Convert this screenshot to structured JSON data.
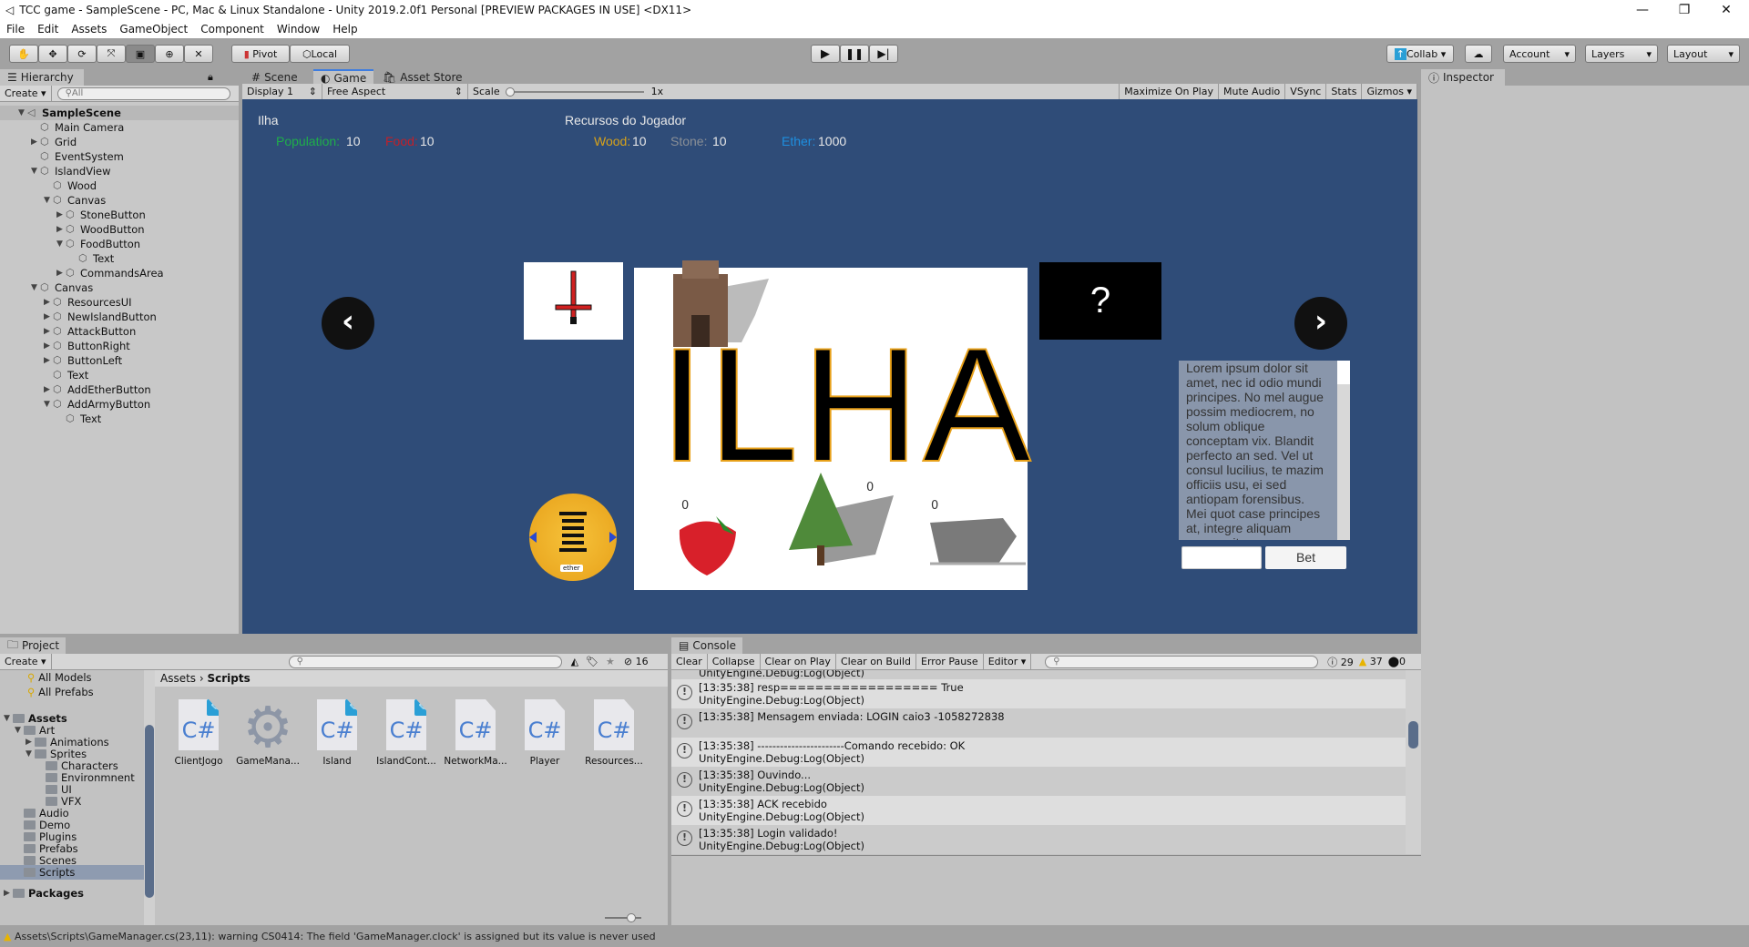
{
  "window": {
    "title": "TCC game - SampleScene - PC, Mac & Linux Standalone - Unity 2019.2.0f1 Personal [PREVIEW PACKAGES IN USE] <DX11>"
  },
  "menu": [
    "File",
    "Edit",
    "Assets",
    "GameObject",
    "Component",
    "Window",
    "Help"
  ],
  "toolbar": {
    "pivot": "Pivot",
    "local": "Local",
    "collab": "Collab ▾",
    "account": "Account",
    "layers": "Layers",
    "layout": "Layout"
  },
  "tabs": {
    "hierarchy": "Hierarchy",
    "scene": "Scene",
    "game": "Game",
    "asset_store": "Asset Store",
    "inspector": "Inspector",
    "project": "Project",
    "console": "Console"
  },
  "hierarchy": {
    "create": "Create",
    "search_placeholder": "All",
    "items": [
      {
        "label": "SampleScene",
        "depth": 0,
        "arrow": "▼",
        "bold": true
      },
      {
        "label": "Main Camera",
        "depth": 1,
        "arrow": ""
      },
      {
        "label": "Grid",
        "depth": 1,
        "arrow": "▶"
      },
      {
        "label": "EventSystem",
        "depth": 1,
        "arrow": ""
      },
      {
        "label": "IslandView",
        "depth": 1,
        "arrow": "▼"
      },
      {
        "label": "Wood",
        "depth": 2,
        "arrow": ""
      },
      {
        "label": "Canvas",
        "depth": 2,
        "arrow": "▼"
      },
      {
        "label": "StoneButton",
        "depth": 3,
        "arrow": "▶"
      },
      {
        "label": "WoodButton",
        "depth": 3,
        "arrow": "▶"
      },
      {
        "label": "FoodButton",
        "depth": 3,
        "arrow": "▼"
      },
      {
        "label": "Text",
        "depth": 4,
        "arrow": ""
      },
      {
        "label": "CommandsArea",
        "depth": 3,
        "arrow": "▶"
      },
      {
        "label": "Canvas",
        "depth": 1,
        "arrow": "▼"
      },
      {
        "label": "ResourcesUI",
        "depth": 2,
        "arrow": "▶"
      },
      {
        "label": "NewIslandButton",
        "depth": 2,
        "arrow": "▶"
      },
      {
        "label": "AttackButton",
        "depth": 2,
        "arrow": "▶"
      },
      {
        "label": "ButtonRight",
        "depth": 2,
        "arrow": "▶"
      },
      {
        "label": "ButtonLeft",
        "depth": 2,
        "arrow": "▶"
      },
      {
        "label": "Text",
        "depth": 2,
        "arrow": ""
      },
      {
        "label": "AddEtherButton",
        "depth": 2,
        "arrow": "▶"
      },
      {
        "label": "AddArmyButton",
        "depth": 2,
        "arrow": "▼"
      },
      {
        "label": "Text",
        "depth": 3,
        "arrow": ""
      }
    ]
  },
  "game_toolbar": {
    "display": "Display 1",
    "aspect": "Free Aspect",
    "scale_label": "Scale",
    "scale_value": "1x",
    "maximize": "Maximize On Play",
    "mute": "Mute Audio",
    "vsync": "VSync",
    "stats": "Stats",
    "gizmos": "Gizmos"
  },
  "game": {
    "island_label": "Ilha",
    "population_label": "Population:",
    "population": "10",
    "food_label": "Food:",
    "food": "10",
    "resources_title": "Recursos do Jogador",
    "wood_label": "Wood:",
    "wood": "10",
    "stone_label": "Stone:",
    "stone": "10",
    "ether_label": "Ether:",
    "ether": "1000",
    "island_name": "ILHA",
    "unknown": "?",
    "food_count": "0",
    "wood_count": "0",
    "stone_count": "0",
    "ether_coin": "ether",
    "lorem": "Lorem ipsum dolor sit amet, nec id odio mundi principes. No mel augue possim mediocrem, no solum oblique conceptam vix. Blandit perfecto an sed. Vel ut consul lucilius, te mazim officiis usu, ei sed antiopam forensibus. Mei quot case principes at, integre aliquam corrumpit mea ne",
    "bet_input": "",
    "bet": "Bet",
    "colors": {
      "population": "#1fae4a",
      "food": "#c0202a",
      "wood": "#d7a21a",
      "stone": "#8a8f96",
      "ether": "#1e8fe0",
      "background": "#2f4c78"
    }
  },
  "project": {
    "create": "Create",
    "hidden_count": "16",
    "favorites": [
      "All Models",
      "All Prefabs"
    ],
    "breadcrumb": [
      "Assets",
      "Scripts"
    ],
    "tree": [
      {
        "label": "Assets",
        "depth": 0,
        "arrow": "▼",
        "bold": true
      },
      {
        "label": "Art",
        "depth": 1,
        "arrow": "▼"
      },
      {
        "label": "Animations",
        "depth": 2,
        "arrow": "▶"
      },
      {
        "label": "Sprites",
        "depth": 2,
        "arrow": "▼"
      },
      {
        "label": "Characters",
        "depth": 3,
        "arrow": ""
      },
      {
        "label": "Environmnent",
        "depth": 3,
        "arrow": ""
      },
      {
        "label": "UI",
        "depth": 3,
        "arrow": ""
      },
      {
        "label": "VFX",
        "depth": 3,
        "arrow": ""
      },
      {
        "label": "Audio",
        "depth": 1,
        "arrow": ""
      },
      {
        "label": "Demo",
        "depth": 1,
        "arrow": ""
      },
      {
        "label": "Plugins",
        "depth": 1,
        "arrow": ""
      },
      {
        "label": "Prefabs",
        "depth": 1,
        "arrow": ""
      },
      {
        "label": "Scenes",
        "depth": 1,
        "arrow": ""
      },
      {
        "label": "Scripts",
        "depth": 1,
        "arrow": "",
        "selected": true
      },
      {
        "label": "Packages",
        "depth": 0,
        "arrow": "▶",
        "bold": true
      }
    ],
    "assets": [
      {
        "name": "ClientJogo",
        "type": "cs",
        "edited": true
      },
      {
        "name": "GameMana...",
        "type": "gear"
      },
      {
        "name": "Island",
        "type": "cs",
        "edited": true
      },
      {
        "name": "IslandCont...",
        "type": "cs",
        "edited": true
      },
      {
        "name": "NetworkMa...",
        "type": "cs"
      },
      {
        "name": "Player",
        "type": "cs"
      },
      {
        "name": "Resources...",
        "type": "cs"
      }
    ]
  },
  "console": {
    "buttons": [
      "Clear",
      "Collapse",
      "Clear on Play",
      "Clear on Build",
      "Error Pause",
      "Editor ▾"
    ],
    "log_count": "29",
    "warn_count": "37",
    "error_count": "0",
    "top_partial": "UnityEngine.Debug:Log(Object)",
    "entries": [
      {
        "line1": "[13:35:38] resp================== True",
        "line2": "UnityEngine.Debug:Log(Object)"
      },
      {
        "line1": "[13:35:38] Mensagem enviada: LOGIN caio3 -1058272838",
        "line2": ""
      },
      {
        "line1": "[13:35:38] -----------------------Comando recebido: OK",
        "line2": "UnityEngine.Debug:Log(Object)"
      },
      {
        "line1": "[13:35:38] Ouvindo...",
        "line2": "UnityEngine.Debug:Log(Object)"
      },
      {
        "line1": "[13:35:38] ACK recebido",
        "line2": "UnityEngine.Debug:Log(Object)"
      },
      {
        "line1": "[13:35:38] Login validado!",
        "line2": "UnityEngine.Debug:Log(Object)"
      }
    ]
  },
  "status": "Assets\\Scripts\\GameManager.cs(23,11): warning CS0414: The field 'GameManager.clock' is assigned but its value is never used"
}
